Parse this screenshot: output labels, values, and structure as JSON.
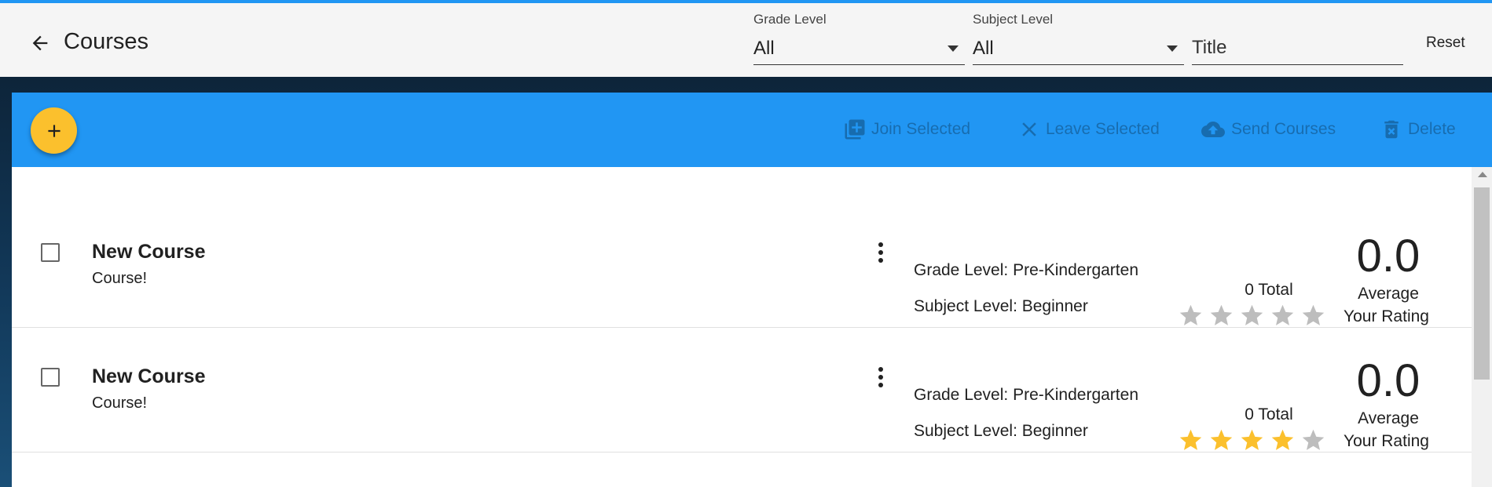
{
  "header": {
    "title": "Courses",
    "grade_filter": {
      "label": "Grade Level",
      "value": "All"
    },
    "subject_filter": {
      "label": "Subject Level",
      "value": "All"
    },
    "title_filter": {
      "placeholder": "Title"
    },
    "reset_label": "Reset"
  },
  "toolbar": {
    "join_label": "Join Selected",
    "leave_label": "Leave Selected",
    "send_label": "Send Courses",
    "delete_label": "Delete"
  },
  "courses": [
    {
      "title": "New Course",
      "description": "Course!",
      "grade_level": "Grade Level: Pre-Kindergarten",
      "subject_level": "Subject Level: Beginner",
      "total": "0 Total",
      "average": "0.0",
      "average_label": "Average",
      "rating_label": "Your Rating",
      "your_rating": 0
    },
    {
      "title": "New Course",
      "description": "Course!",
      "grade_level": "Grade Level: Pre-Kindergarten",
      "subject_level": "Subject Level: Beginner",
      "total": "0 Total",
      "average": "0.0",
      "average_label": "Average",
      "rating_label": "Your Rating",
      "your_rating": 4
    }
  ],
  "colors": {
    "accent": "#2196f3",
    "fab": "#fbc02d",
    "star_filled": "#fbc02d",
    "star_empty": "#bdbdbd"
  }
}
